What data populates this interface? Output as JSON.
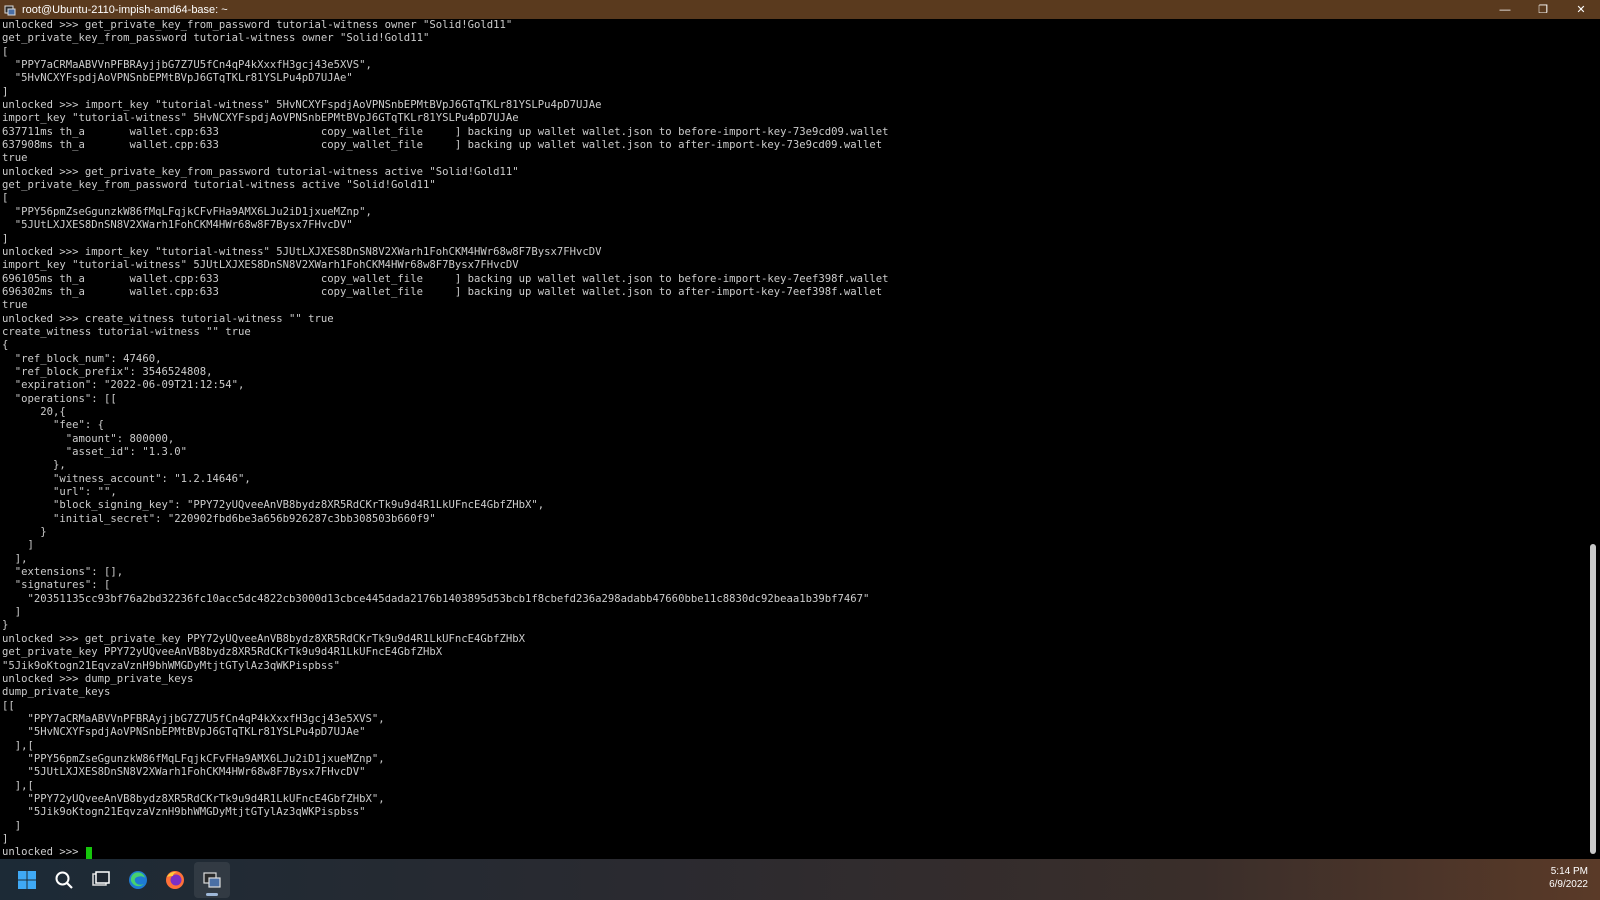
{
  "window": {
    "title": "root@Ubuntu-2110-impish-amd64-base: ~",
    "minimize_glyph": "—",
    "maximize_glyph": "❐",
    "close_glyph": "✕"
  },
  "terminal": {
    "output": "unlocked >>> get_private_key_from_password tutorial-witness owner \"Solid!Gold11\"\nget_private_key_from_password tutorial-witness owner \"Solid!Gold11\"\n[\n  \"PPY7aCRMaABVVnPFBRAyjjbG7Z7U5fCn4qP4kXxxfH3gcj43e5XVS\",\n  \"5HvNCXYFspdjAoVPNSnbEPMtBVpJ6GTqTKLr81YSLPu4pD7UJAe\"\n]\nunlocked >>> import_key \"tutorial-witness\" 5HvNCXYFspdjAoVPNSnbEPMtBVpJ6GTqTKLr81YSLPu4pD7UJAe\nimport_key \"tutorial-witness\" 5HvNCXYFspdjAoVPNSnbEPMtBVpJ6GTqTKLr81YSLPu4pD7UJAe\n637711ms th_a       wallet.cpp:633                copy_wallet_file     ] backing up wallet wallet.json to before-import-key-73e9cd09.wallet\n637908ms th_a       wallet.cpp:633                copy_wallet_file     ] backing up wallet wallet.json to after-import-key-73e9cd09.wallet\ntrue\nunlocked >>> get_private_key_from_password tutorial-witness active \"Solid!Gold11\"\nget_private_key_from_password tutorial-witness active \"Solid!Gold11\"\n[\n  \"PPY56pmZseGgunzkW86fMqLFqjkCFvFHa9AMX6LJu2iD1jxueMZnp\",\n  \"5JUtLXJXES8DnSN8V2XWarh1FohCKM4HWr68w8F7Bysx7FHvcDV\"\n]\nunlocked >>> import_key \"tutorial-witness\" 5JUtLXJXES8DnSN8V2XWarh1FohCKM4HWr68w8F7Bysx7FHvcDV\nimport_key \"tutorial-witness\" 5JUtLXJXES8DnSN8V2XWarh1FohCKM4HWr68w8F7Bysx7FHvcDV\n696105ms th_a       wallet.cpp:633                copy_wallet_file     ] backing up wallet wallet.json to before-import-key-7eef398f.wallet\n696302ms th_a       wallet.cpp:633                copy_wallet_file     ] backing up wallet wallet.json to after-import-key-7eef398f.wallet\ntrue\nunlocked >>> create_witness tutorial-witness \"\" true\ncreate_witness tutorial-witness \"\" true\n{\n  \"ref_block_num\": 47460,\n  \"ref_block_prefix\": 3546524808,\n  \"expiration\": \"2022-06-09T21:12:54\",\n  \"operations\": [[\n      20,{\n        \"fee\": {\n          \"amount\": 800000,\n          \"asset_id\": \"1.3.0\"\n        },\n        \"witness_account\": \"1.2.14646\",\n        \"url\": \"\",\n        \"block_signing_key\": \"PPY72yUQveeAnVB8bydz8XR5RdCKrTk9u9d4R1LkUFncE4GbfZHbX\",\n        \"initial_secret\": \"220902fbd6be3a656b926287c3bb308503b660f9\"\n      }\n    ]\n  ],\n  \"extensions\": [],\n  \"signatures\": [\n    \"20351135cc93bf76a2bd32236fc10acc5dc4822cb3000d13cbce445dada2176b1403895d53bcb1f8cbefd236a298adabb47660bbe11c8830dc92beaa1b39bf7467\"\n  ]\n}\nunlocked >>> get_private_key PPY72yUQveeAnVB8bydz8XR5RdCKrTk9u9d4R1LkUFncE4GbfZHbX\nget_private_key PPY72yUQveeAnVB8bydz8XR5RdCKrTk9u9d4R1LkUFncE4GbfZHbX\n\"5Jik9oKtogn21EqvzaVznH9bhWMGDyMtjtGTylAz3qWKPispbss\"\nunlocked >>> dump_private_keys\ndump_private_keys\n[[\n    \"PPY7aCRMaABVVnPFBRAyjjbG7Z7U5fCn4qP4kXxxfH3gcj43e5XVS\",\n    \"5HvNCXYFspdjAoVPNSnbEPMtBVpJ6GTqTKLr81YSLPu4pD7UJAe\"\n  ],[\n    \"PPY56pmZseGgunzkW86fMqLFqjkCFvFHa9AMX6LJu2iD1jxueMZnp\",\n    \"5JUtLXJXES8DnSN8V2XWarh1FohCKM4HWr68w8F7Bysx7FHvcDV\"\n  ],[\n    \"PPY72yUQveeAnVB8bydz8XR5RdCKrTk9u9d4R1LkUFncE4GbfZHbX\",\n    \"5Jik9oKtogn21EqvzaVznH9bhWMGDyMtjtGTylAz3qWKPispbss\"\n  ]\n]",
    "prompt": "unlocked >>> ",
    "cursor_color": "#16c60c",
    "background": "#000000",
    "foreground": "#cccccc"
  },
  "taskbar": {
    "icons": [
      {
        "name": "windows-start-icon"
      },
      {
        "name": "search-icon"
      },
      {
        "name": "task-view-icon"
      },
      {
        "name": "edge-browser-icon"
      },
      {
        "name": "firefox-icon"
      },
      {
        "name": "terminal-app-icon",
        "active": true
      }
    ],
    "time": "5:14 PM",
    "date": "6/9/2022"
  }
}
